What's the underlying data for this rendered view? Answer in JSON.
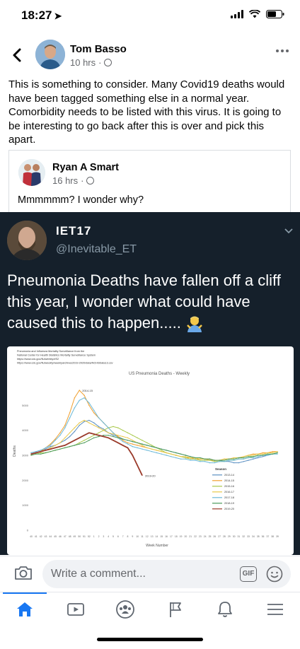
{
  "status_bar": {
    "time": "18:27",
    "location_arrow": "location-arrow-icon",
    "signal": "cellular-signal-icon",
    "wifi": "wifi-icon",
    "battery": "battery-icon"
  },
  "post": {
    "author": "Tom Basso",
    "time": "10 hrs",
    "separator": "·",
    "privacy_icon": "globe-icon",
    "text": "This is something to consider. Many Covid19 deaths would have been tagged something else in a normal year. Comorbidity needs to be listed with this virus. It is going to be interesting to go back after this is over and pick this apart."
  },
  "shared_post": {
    "author": "Ryan A Smart",
    "time": "16 hrs",
    "separator": "·",
    "text": "Mmmmmm? I wonder why?"
  },
  "tweet": {
    "name": "IET17",
    "handle": "@Inevitable_ET",
    "text": "Pneumonia Deaths have fallen off a cliff this year, I wonder what could have caused this to happen.....",
    "emoji": "person-shrugging-emoji"
  },
  "chart_data": {
    "type": "line",
    "title": "US Pneumonia Deaths - Weekly",
    "header_lines": [
      "Pneumonia and Influenza Mortality Surveillance from the",
      "National Center for Health Statistics Mortality Surveillance System",
      "https://www.cdc.gov/flu/weekly/#S2",
      "https://www.cdc.gov/flu/weekly/weeklyarchives2019-2020/data/NCHSData13.csv"
    ],
    "xlabel": "Week Number",
    "ylabel": "Deaths",
    "y_ticks": [
      "5000",
      "4000",
      "3000",
      "2000",
      "1000",
      "0"
    ],
    "ylim": [
      0,
      6000
    ],
    "x_ticks": [
      "40",
      "41",
      "42",
      "43",
      "44",
      "45",
      "46",
      "47",
      "48",
      "49",
      "50",
      "51",
      "52",
      "1",
      "2",
      "3",
      "4",
      "5",
      "6",
      "7",
      "8",
      "9",
      "10",
      "11",
      "12",
      "13",
      "14",
      "15",
      "16",
      "17",
      "18",
      "19",
      "20",
      "21",
      "22",
      "23",
      "24",
      "25",
      "26",
      "27",
      "28",
      "29",
      "30",
      "31",
      "32",
      "33",
      "34",
      "35",
      "36",
      "37",
      "38",
      "39"
    ],
    "annotations": [
      "2014-15",
      "2019-20"
    ],
    "legend_title": "Season",
    "legend_position": "right",
    "series": [
      {
        "name": "2013-14",
        "color": "#5a8fc2",
        "values": [
          3100,
          3150,
          3200,
          3250,
          3350,
          3400,
          3500,
          3600,
          3750,
          3950,
          4200,
          4350,
          4400,
          4300,
          4150,
          4050,
          3900,
          3800,
          3750,
          3650,
          3600,
          3550,
          3500,
          3450,
          3400,
          3350,
          3300,
          3250,
          3200,
          3150,
          3100,
          3050,
          3000,
          2950,
          2900,
          2900,
          2850,
          2850,
          2800,
          2800,
          2750,
          2750,
          2700,
          2700,
          2750,
          2800,
          2850,
          2900,
          2950,
          3000,
          3050,
          3100
        ]
      },
      {
        "name": "2014-15",
        "color": "#f0a030",
        "values": [
          3050,
          3100,
          3150,
          3300,
          3450,
          3650,
          3900,
          4200,
          4700,
          5300,
          5600,
          5400,
          5000,
          4700,
          4500,
          4300,
          4100,
          3900,
          3750,
          3600,
          3500,
          3450,
          3400,
          3350,
          3300,
          3250,
          3200,
          3150,
          3100,
          3050,
          3000,
          2950,
          2900,
          2900,
          2850,
          2850,
          2850,
          2800,
          2800,
          2800,
          2850,
          2850,
          2900,
          2900,
          2950,
          3000,
          3050,
          3050,
          3100,
          3100,
          3150,
          3150
        ]
      },
      {
        "name": "2015-16",
        "color": "#a8c84a",
        "values": [
          3000,
          3050,
          3100,
          3100,
          3150,
          3200,
          3250,
          3300,
          3350,
          3400,
          3500,
          3600,
          3700,
          3800,
          3900,
          4000,
          4100,
          4150,
          4100,
          4000,
          3900,
          3800,
          3700,
          3600,
          3500,
          3400,
          3300,
          3200,
          3100,
          3050,
          3000,
          2950,
          2900,
          2850,
          2850,
          2800,
          2800,
          2800,
          2750,
          2750,
          2750,
          2800,
          2800,
          2850,
          2850,
          2900,
          2950,
          3000,
          3000,
          3050,
          3050,
          3100
        ]
      },
      {
        "name": "2016-17",
        "color": "#e8c84a",
        "values": [
          3050,
          3100,
          3150,
          3200,
          3300,
          3400,
          3500,
          3700,
          3900,
          4100,
          4300,
          4400,
          4300,
          4200,
          4100,
          4000,
          3900,
          3850,
          3800,
          3750,
          3700,
          3600,
          3500,
          3400,
          3300,
          3250,
          3200,
          3150,
          3100,
          3050,
          3000,
          2950,
          2950,
          2900,
          2900,
          2850,
          2850,
          2850,
          2800,
          2800,
          2850,
          2850,
          2900,
          2900,
          2950,
          3000,
          3000,
          3050,
          3050,
          3100,
          3100,
          3150
        ]
      },
      {
        "name": "2017-18",
        "color": "#6bb8d8",
        "values": [
          3100,
          3150,
          3200,
          3300,
          3400,
          3600,
          3800,
          4100,
          4500,
          4900,
          5200,
          5300,
          5100,
          4800,
          4500,
          4300,
          4100,
          3900,
          3700,
          3550,
          3450,
          3350,
          3300,
          3250,
          3200,
          3150,
          3100,
          3050,
          3000,
          2950,
          2900,
          2850,
          2850,
          2800,
          2800,
          2750,
          2750,
          2700,
          2700,
          2750,
          2750,
          2800,
          2800,
          2850,
          2850,
          2900,
          2900,
          2950,
          3000,
          3000,
          3050,
          3050
        ]
      },
      {
        "name": "2018-19",
        "color": "#4a9a5a",
        "values": [
          3000,
          3050,
          3050,
          3100,
          3150,
          3200,
          3250,
          3300,
          3350,
          3400,
          3450,
          3500,
          3600,
          3700,
          3750,
          3800,
          3800,
          3750,
          3700,
          3650,
          3600,
          3550,
          3500,
          3450,
          3400,
          3350,
          3300,
          3250,
          3200,
          3150,
          3100,
          3050,
          3000,
          2950,
          2900,
          2900,
          2850,
          2850,
          2800,
          2800,
          2800,
          2850,
          2850,
          2900,
          2900,
          2950,
          2950,
          3000,
          3000,
          3050,
          3050,
          3100
        ]
      },
      {
        "name": "2019-20",
        "color": "#9a3a2a",
        "values": [
          3050,
          3100,
          3150,
          3200,
          3250,
          3300,
          3350,
          3400,
          3500,
          3600,
          3700,
          3800,
          3900,
          3850,
          3800,
          3750,
          3700,
          3600,
          3500,
          3400,
          3300,
          3000,
          2600,
          2200,
          null,
          null,
          null,
          null,
          null,
          null,
          null,
          null,
          null,
          null,
          null,
          null,
          null,
          null,
          null,
          null,
          null,
          null,
          null,
          null,
          null,
          null,
          null,
          null,
          null,
          null,
          null,
          null
        ]
      }
    ]
  },
  "comment_bar": {
    "placeholder": "Write a comment...",
    "gif_label": "GIF"
  },
  "nav": {
    "items": [
      "home-icon",
      "video-icon",
      "groups-icon",
      "pages-flag-icon",
      "notifications-bell-icon",
      "menu-icon"
    ]
  }
}
